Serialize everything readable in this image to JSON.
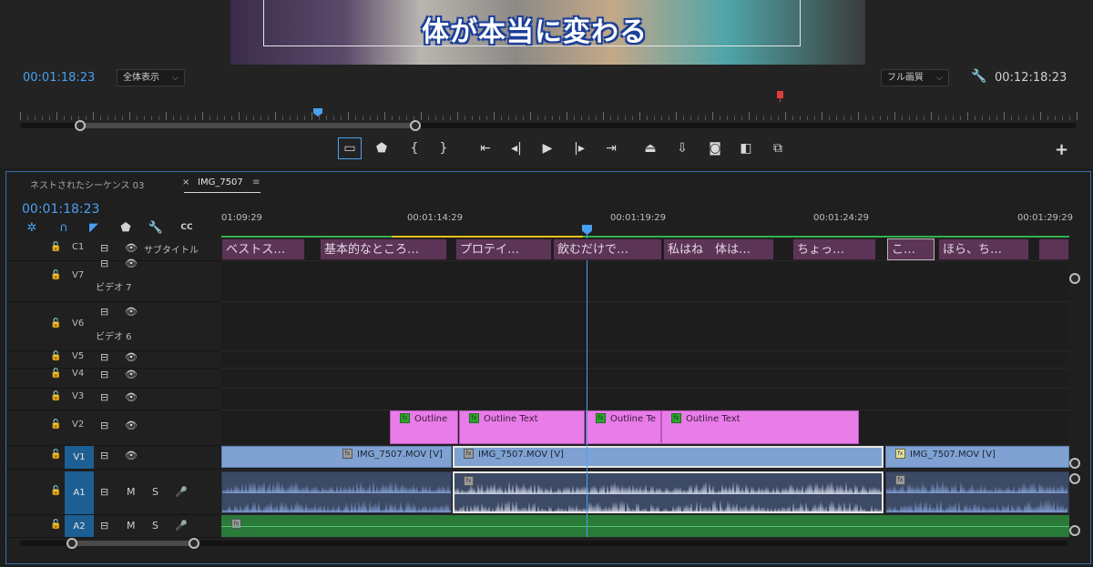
{
  "monitor": {
    "caption": "体が本当に変わる",
    "current_timecode": "00:01:18:23",
    "zoom_select": "全体表示",
    "quality_select": "フル画質",
    "duration_timecode": "00:12:18:23",
    "buttons": [
      {
        "name": "safe-margins-button",
        "glyph": "▭"
      },
      {
        "name": "add-marker-button",
        "glyph": "⬟"
      },
      {
        "name": "mark-in-button",
        "glyph": "{"
      },
      {
        "name": "mark-out-button",
        "glyph": "}"
      },
      {
        "name": "go-to-in-button",
        "glyph": "⇤"
      },
      {
        "name": "step-back-button",
        "glyph": "◂|"
      },
      {
        "name": "play-button",
        "glyph": "▶"
      },
      {
        "name": "step-forward-button",
        "glyph": "|▸"
      },
      {
        "name": "go-to-out-button",
        "glyph": "⇥"
      },
      {
        "name": "lift-button",
        "glyph": "⏏"
      },
      {
        "name": "extract-button",
        "glyph": "⇩"
      },
      {
        "name": "export-frame-button",
        "glyph": "◙"
      },
      {
        "name": "compare-view-button",
        "glyph": "◧"
      },
      {
        "name": "proxy-toggle-button",
        "glyph": "⧉"
      }
    ],
    "add_button": "+"
  },
  "timeline": {
    "tabs": [
      {
        "label": "ネストされたシーケンス 03",
        "active": false
      },
      {
        "label": "IMG_7507",
        "active": true
      }
    ],
    "tab_close": "×",
    "tab_menu": "≡",
    "current_timecode": "00:01:18:23",
    "ruler_labels": [
      "01:09:29",
      "00:01:14:29",
      "00:01:19:29",
      "00:01:24:29",
      "00:01:29:29"
    ],
    "tools": [
      {
        "name": "snap-icon",
        "glyph": "✲"
      },
      {
        "name": "magnet-icon",
        "glyph": "∩"
      },
      {
        "name": "linked-selection-icon",
        "glyph": "◤"
      },
      {
        "name": "marker-icon",
        "glyph": "⬟"
      },
      {
        "name": "wrench-icon",
        "glyph": "🔧"
      },
      {
        "name": "captions-icon",
        "glyph": "CC"
      }
    ],
    "tracks": {
      "c1": {
        "label": "C1",
        "name": "サブタイトル"
      },
      "v7": {
        "label": "V7",
        "name": "ビデオ 7"
      },
      "v6": {
        "label": "V6",
        "name": "ビデオ 6"
      },
      "v5": {
        "label": "V5"
      },
      "v4": {
        "label": "V4"
      },
      "v3": {
        "label": "V3"
      },
      "v2": {
        "label": "V2"
      },
      "v1": {
        "label": "V1",
        "src": "V1"
      },
      "a1": {
        "label": "A1",
        "src": "A1",
        "m": "M",
        "s": "S"
      },
      "a2": {
        "label": "A2",
        "src": "A2",
        "m": "M",
        "s": "S"
      }
    },
    "caption_clips": [
      "ベストス…",
      "基本的なところ…",
      "プロテイ…",
      "飲むだけで…",
      "私はね　体は…",
      "ちょっ…",
      "こ…",
      "ほら、ち…"
    ],
    "v2_clips": [
      "Outline",
      "Outline Text",
      "Outline Te",
      "Outline Text"
    ],
    "v1_clips": [
      "IMG_7507.MOV [V]",
      "IMG_7507.MOV [V]",
      "IMG_7507.MOV [V]"
    ],
    "fx_label": "fx"
  },
  "colors": {
    "accent": "#4aa0f0",
    "caption_clip": "#5c3556",
    "v2_clip": "#e87ce8",
    "v1_clip": "#7fa2d2",
    "audio_clip": "#3d4a66",
    "a2_track": "#2a7a3a",
    "playhead": "#4aa0f0",
    "marker_red": "#e03c3c"
  }
}
